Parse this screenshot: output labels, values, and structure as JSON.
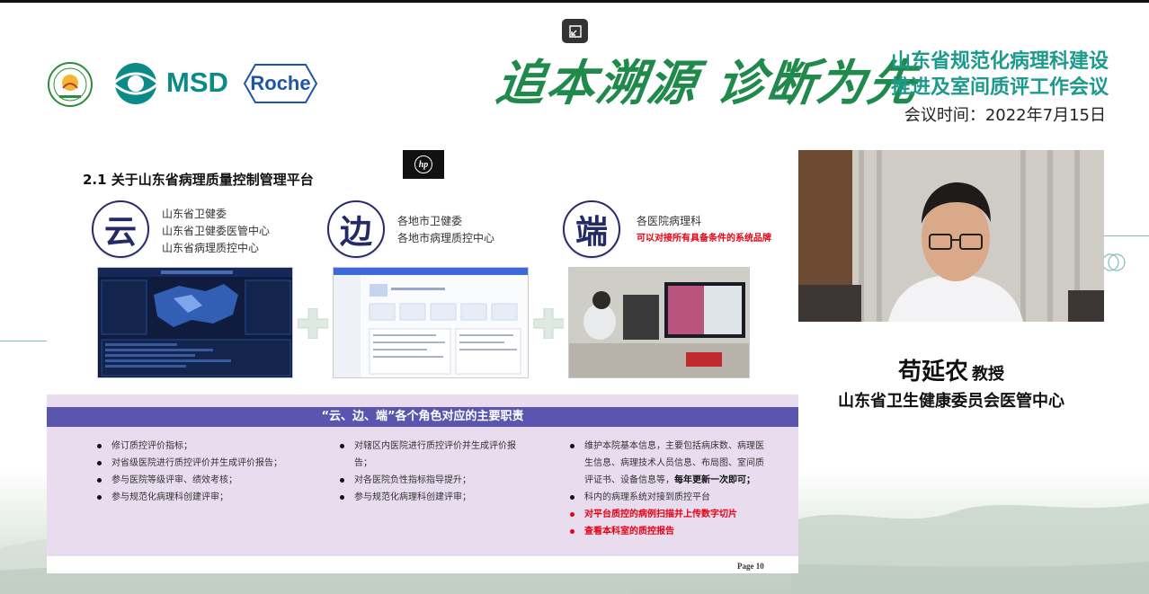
{
  "header": {
    "logos": [
      "association-logo",
      "msd-logo",
      "roche-logo"
    ],
    "msd_text": "MSD",
    "roche_text": "Roche",
    "slogan": "追本溯源 诊断为先",
    "conference_title_line1": "山东省规范化病理科建设",
    "conference_title_line2": "推进及室间质评工作会议",
    "conference_date": "会议时间：2022年7月15日"
  },
  "slide": {
    "title": "2.1 关于山东省病理质量控制管理平台",
    "hp_logo_text": "hp",
    "roles": [
      {
        "char": "云",
        "lines": [
          "山东省卫健委",
          "山东省卫健委医管中心",
          "山东省病理质控中心"
        ],
        "note": ""
      },
      {
        "char": "边",
        "lines": [
          "各地市卫健委",
          "各地市病理质控中心"
        ],
        "note": ""
      },
      {
        "char": "端",
        "lines": [
          "各医院病理科"
        ],
        "note": "可以对接所有具备条件的系统品牌"
      }
    ],
    "duties_header": "“云、边、端”各个角色对应的主要职责",
    "duties": {
      "cloud": [
        "修订质控评价指标；",
        "对省级医院进行质控评价并生成评价报告；",
        "参与医院等级评审、绩效考核；",
        "参与规范化病理科创建评审；"
      ],
      "edge": [
        "对辖区内医院进行质控评价并生成评价报告；",
        "对各医院负性指标指导提升；",
        "参与规范化病理科创建评审；"
      ],
      "end": {
        "item1_text": "维护本院基本信息，主要包括病床数、病理医生信息、病理技术人员信息、布局图、室间质评证书、设备信息等，",
        "item1_bold": "每年更新一次即可；",
        "item2": "科内的病理系统对接到质控平台",
        "item3_red": "对平台质控的病例扫描并上传数字切片",
        "item4_red": "查看本科室的质控报告"
      }
    },
    "page_label": "Page  10"
  },
  "speaker": {
    "name": "苟延农",
    "title": "教授",
    "organization": "山东省卫生健康委员会医管中心"
  },
  "colors": {
    "brand_green": "#1f8a4c",
    "teal": "#1c9a8c",
    "duty_header_bg": "#5a56b0",
    "duty_area_bg": "#e9dcef",
    "alert_red": "#e60012"
  }
}
